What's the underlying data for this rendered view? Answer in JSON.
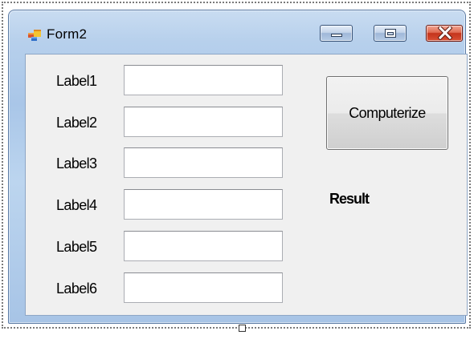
{
  "window": {
    "title": "Form2",
    "icon": "form-icon",
    "caption_buttons": [
      "minimize-icon",
      "maximize-icon",
      "close-icon"
    ]
  },
  "form": {
    "fields": [
      {
        "label": "Label1",
        "value": ""
      },
      {
        "label": "Label2",
        "value": ""
      },
      {
        "label": "Label3",
        "value": ""
      },
      {
        "label": "Label4",
        "value": ""
      },
      {
        "label": "Label5",
        "value": ""
      },
      {
        "label": "Label6",
        "value": ""
      }
    ],
    "button_label": "Computerize",
    "result_label": "Result"
  },
  "colors": {
    "titlebar": "#b7d0ec",
    "client_background": "#f0f0f0",
    "close_button": "#c4341c"
  }
}
